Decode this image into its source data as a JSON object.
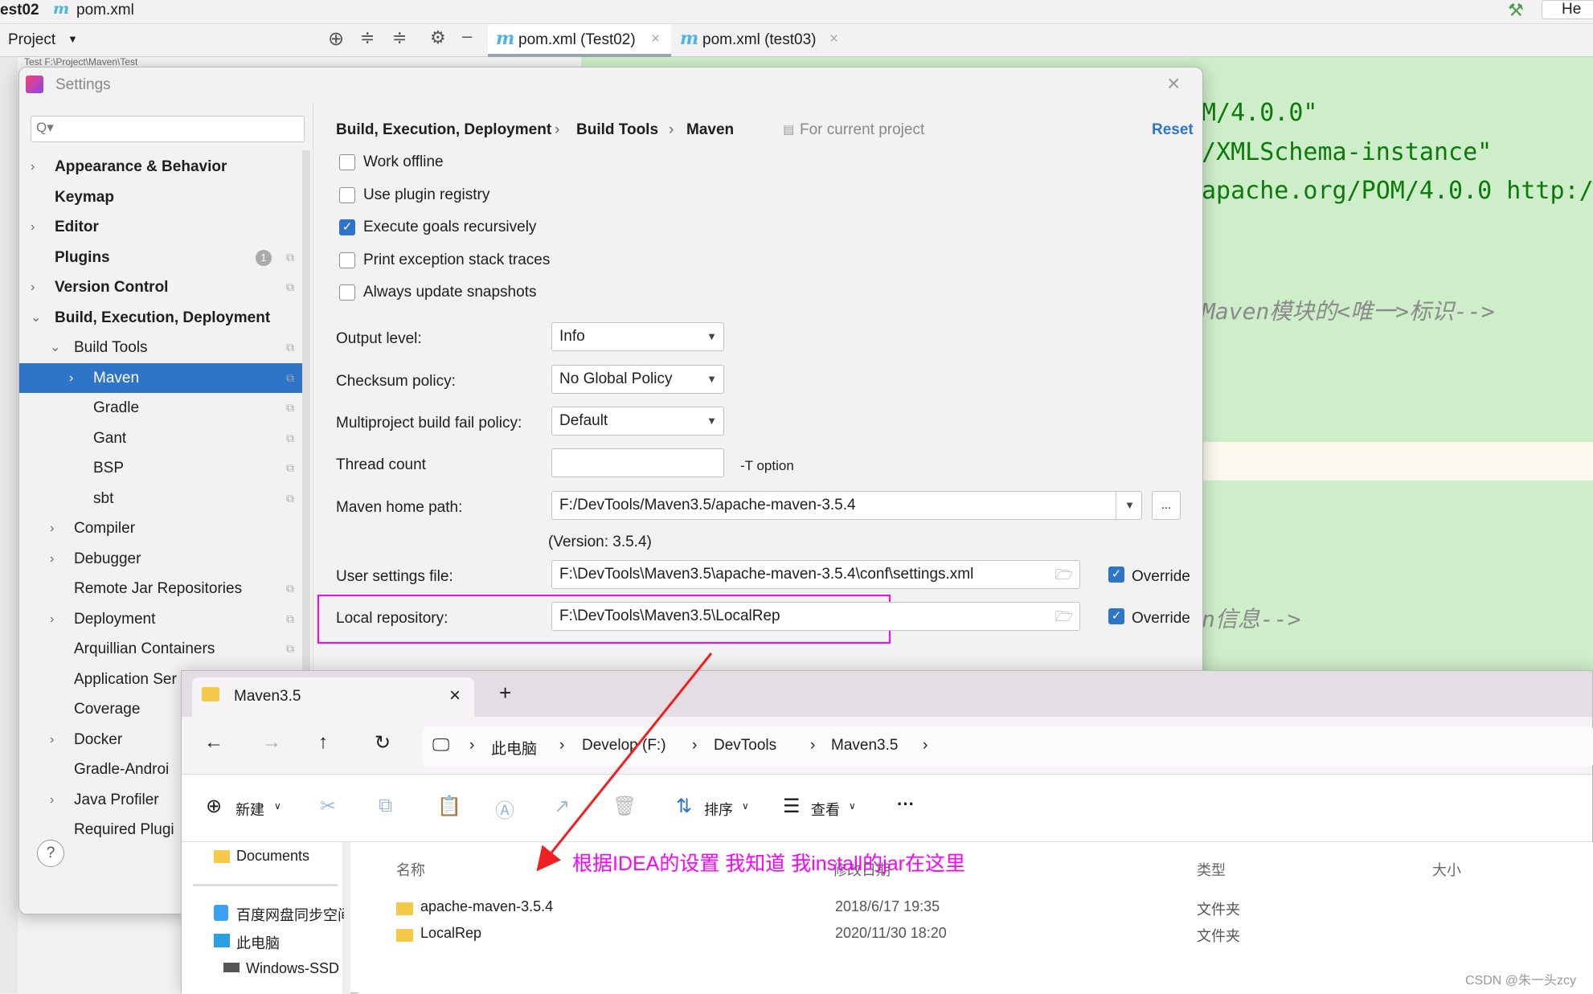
{
  "ide": {
    "breadcrumb_project": "est02",
    "breadcrumb_file": "pom.xml",
    "top_right": "He",
    "tool_window": "Project",
    "tree_hint": "Test F:\\Project\\Maven\\Test",
    "tabs": [
      {
        "label": "pom.xml (Test02)",
        "active": true
      },
      {
        "label": "pom.xml (test03)",
        "active": false
      }
    ],
    "code_lines": [
      "M/4.0.0\"",
      "/XMLSchema-instance\"",
      "apache.org/POM/4.0.0 http:/"
    ],
    "comments": [
      "Maven模块的<唯一>标识-->",
      "n信息-->"
    ]
  },
  "settings": {
    "title": "Settings",
    "search_placeholder": "Q▾",
    "tree": [
      {
        "label": "Appearance & Behavior",
        "bold": true,
        "chev": ">",
        "indent": 0
      },
      {
        "label": "Keymap",
        "bold": true,
        "indent": 0
      },
      {
        "label": "Editor",
        "bold": true,
        "chev": ">",
        "indent": 0
      },
      {
        "label": "Plugins",
        "bold": true,
        "indent": 0,
        "badge": "1"
      },
      {
        "label": "Version Control",
        "bold": true,
        "chev": ">",
        "indent": 0
      },
      {
        "label": "Build, Execution, Deployment",
        "bold": true,
        "chev": "v",
        "indent": 0
      },
      {
        "label": "Build Tools",
        "chev": "v",
        "indent": 1
      },
      {
        "label": "Maven",
        "chev": ">",
        "indent": 2,
        "selected": true
      },
      {
        "label": "Gradle",
        "indent": 2
      },
      {
        "label": "Gant",
        "indent": 2
      },
      {
        "label": "BSP",
        "indent": 2
      },
      {
        "label": "sbt",
        "indent": 2
      },
      {
        "label": "Compiler",
        "chev": ">",
        "indent": 1
      },
      {
        "label": "Debugger",
        "chev": ">",
        "indent": 1
      },
      {
        "label": "Remote Jar Repositories",
        "indent": 1
      },
      {
        "label": "Deployment",
        "chev": ">",
        "indent": 1
      },
      {
        "label": "Arquillian Containers",
        "indent": 1
      },
      {
        "label": "Application Ser",
        "indent": 1
      },
      {
        "label": "Coverage",
        "indent": 1
      },
      {
        "label": "Docker",
        "chev": ">",
        "indent": 1
      },
      {
        "label": "Gradle-Androi",
        "indent": 1
      },
      {
        "label": "Java Profiler",
        "chev": ">",
        "indent": 1
      },
      {
        "label": "Required Plugi",
        "indent": 1
      }
    ],
    "breadcrumb": [
      "Build, Execution, Deployment",
      "Build Tools",
      "Maven"
    ],
    "scope": "For current project",
    "reset": "Reset",
    "checkboxes": [
      {
        "label": "Work offline",
        "checked": false
      },
      {
        "label": "Use plugin registry",
        "checked": false
      },
      {
        "label": "Execute goals recursively",
        "checked": true
      },
      {
        "label": "Print exception stack traces",
        "checked": false
      },
      {
        "label": "Always update snapshots",
        "checked": false
      }
    ],
    "output_level": {
      "label": "Output level:",
      "value": "Info"
    },
    "checksum": {
      "label": "Checksum policy:",
      "value": "No Global Policy"
    },
    "multiproject": {
      "label": "Multiproject build fail policy:",
      "value": "Default"
    },
    "thread": {
      "label": "Thread count",
      "value": "",
      "hint": "-T option"
    },
    "maven_home": {
      "label": "Maven home path:",
      "value": "F:/DevTools/Maven3.5/apache-maven-3.5.4",
      "browse": "...",
      "version": "(Version: 3.5.4)"
    },
    "user_settings": {
      "label": "User settings file:",
      "value": "F:\\DevTools\\Maven3.5\\apache-maven-3.5.4\\conf\\settings.xml",
      "override": "Override",
      "override_checked": true
    },
    "local_repo": {
      "label": "Local repository:",
      "value": "F:\\DevTools\\Maven3.5\\LocalRep",
      "override": "Override",
      "override_checked": true
    },
    "help": "?"
  },
  "explorer": {
    "tab": "Maven3.5",
    "new_tab": "+",
    "path": [
      "此电脑",
      "Develop (F:)",
      "DevTools",
      "Maven3.5"
    ],
    "commands": {
      "new": "新建",
      "sort": "排序",
      "view": "查看",
      "more": "···"
    },
    "sidebar": [
      "Documents",
      "百度网盘同步空间",
      "此电脑",
      "Windows-SSD"
    ],
    "columns": [
      "名称",
      "修改日期",
      "类型",
      "大小"
    ],
    "rows": [
      {
        "name": "apache-maven-3.5.4",
        "date": "2018/6/17 19:35",
        "type": "文件夹"
      },
      {
        "name": "LocalRep",
        "date": "2020/11/30 18:20",
        "type": "文件夹"
      }
    ]
  },
  "annotation": {
    "text": "根据IDEA的设置 我知道 我install的jar在这里",
    "color": "#ff00ff"
  },
  "watermark": "CSDN @朱一头zcy"
}
